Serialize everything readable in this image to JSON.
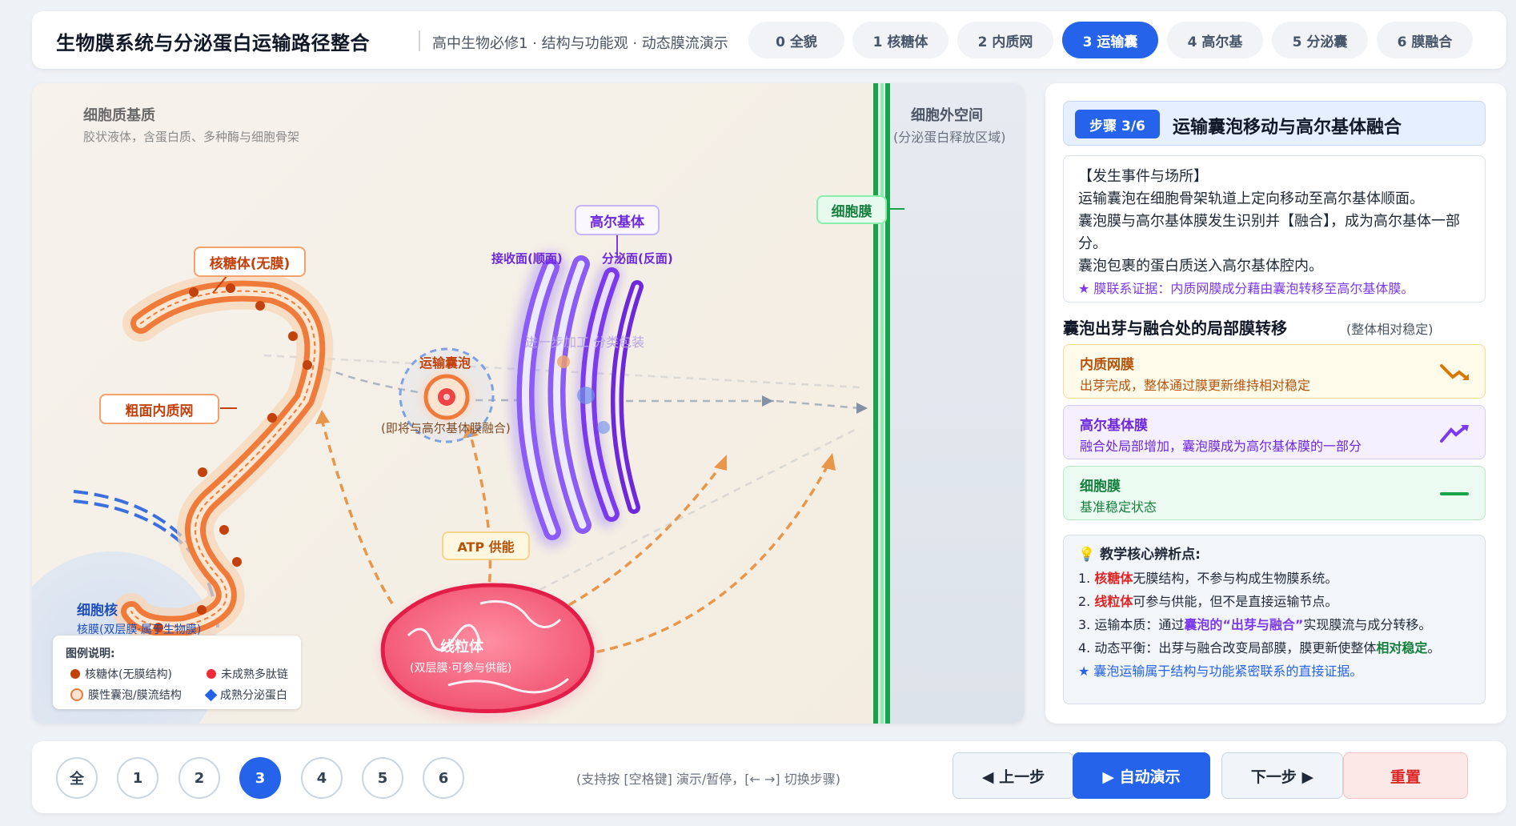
{
  "header": {
    "title": "生物膜系统与分泌蛋白运输路径整合",
    "subtitle": "高中生物必修1 · 结构与功能观 · 动态膜流演示",
    "tabs": [
      "0 全貌",
      "1 核糖体",
      "2 内质网",
      "3 运输囊",
      "4 高尔基",
      "5 分泌囊",
      "6 膜融合"
    ],
    "active_tab": 3
  },
  "diagram": {
    "cytoplasm_title": "细胞质基质",
    "cytoplasm_desc": "胶状液体，含蛋白质、多种酶与细胞骨架",
    "extracellular_title": "细胞外空间",
    "extracellular_desc": "(分泌蛋白释放区域)",
    "cell_membrane_label": "细胞膜",
    "ribosome_label": "核糖体(无膜)",
    "rough_er_label": "粗面内质网",
    "golgi_label": "高尔基体",
    "golgi_cis": "接收面(顺面)",
    "golgi_trans": "分泌面(反面)",
    "golgi_process": "进一步加工 分类包装",
    "vesicle_label": "运输囊泡",
    "vesicle_desc": "(即将与高尔基体膜融合)",
    "atp_label": "ATP 供能",
    "mito_label": "线粒体",
    "mito_desc": "(双层膜·可参与供能)",
    "nucleus_label": "细胞核",
    "nucleus_desc": "核膜(双层膜·属于生物膜)",
    "colors": {
      "er": "#f07a3a",
      "golgi": "#8b5cf6",
      "mito": "#ef4d6b",
      "membrane": "#16a34a",
      "vesicle": "#dc2626"
    }
  },
  "legend": {
    "title": "图例说明:",
    "items": [
      "核糖体(无膜结构)",
      "未成熟多肽链",
      "膜性囊泡/膜流结构",
      "成熟分泌蛋白"
    ]
  },
  "info": {
    "step_badge": "步骤 3/6",
    "step_title": "运输囊泡移动与高尔基体融合",
    "event_title": "【发生事件与场所】",
    "event_lines": [
      "运输囊泡在细胞骨架轨道上定向移动至高尔基体顺面。",
      "囊泡膜与高尔基体膜发生识别并【融合】，成为高尔基体一部分。",
      "囊泡包裹的蛋白质送入高尔基体腔内。"
    ],
    "event_note": "★ 膜联系证据：内质网膜成分藉由囊泡转移至高尔基体膜。",
    "membrane_title": "囊泡出芽与融合处的局部膜转移",
    "membrane_sub": "(整体相对稳定)",
    "membranes": [
      {
        "name": "内质网膜",
        "desc": "出芽完成，整体通过膜更新维持相对稳定"
      },
      {
        "name": "高尔基体膜",
        "desc": "融合处局部增加，囊泡膜成为高尔基体膜的一部分"
      },
      {
        "name": "细胞膜",
        "desc": "基准稳定状态"
      }
    ],
    "key_title": "教学核心辨析点:",
    "key_points": [
      {
        "pre": "1. ",
        "hl": "核糖体",
        "post": "无膜结构，不参与构成生物膜系统。"
      },
      {
        "pre": "2. ",
        "hl": "线粒体",
        "post": "可参与供能，但不是直接运输节点。"
      },
      {
        "pre": "3. 运输本质：通过",
        "hl": "囊泡的“出芽与融合”",
        "post": "实现膜流与成分转移。"
      },
      {
        "pre": "4. 动态平衡：出芽与融合改变局部膜，膜更新使整体",
        "hl": "相对稳定",
        "post": "。"
      }
    ],
    "key_note": "★ 囊泡运输属于结构与功能紧密联系的直接证据。"
  },
  "footer": {
    "steps": [
      "全",
      "1",
      "2",
      "3",
      "4",
      "5",
      "6"
    ],
    "active_step": 3,
    "hint": "(支持按 [空格键] 演示/暂停，[← →] 切换步骤)",
    "prev": "◀ 上一步",
    "auto": "▶ 自动演示",
    "next": "下一步 ▶",
    "reset": "重置"
  }
}
